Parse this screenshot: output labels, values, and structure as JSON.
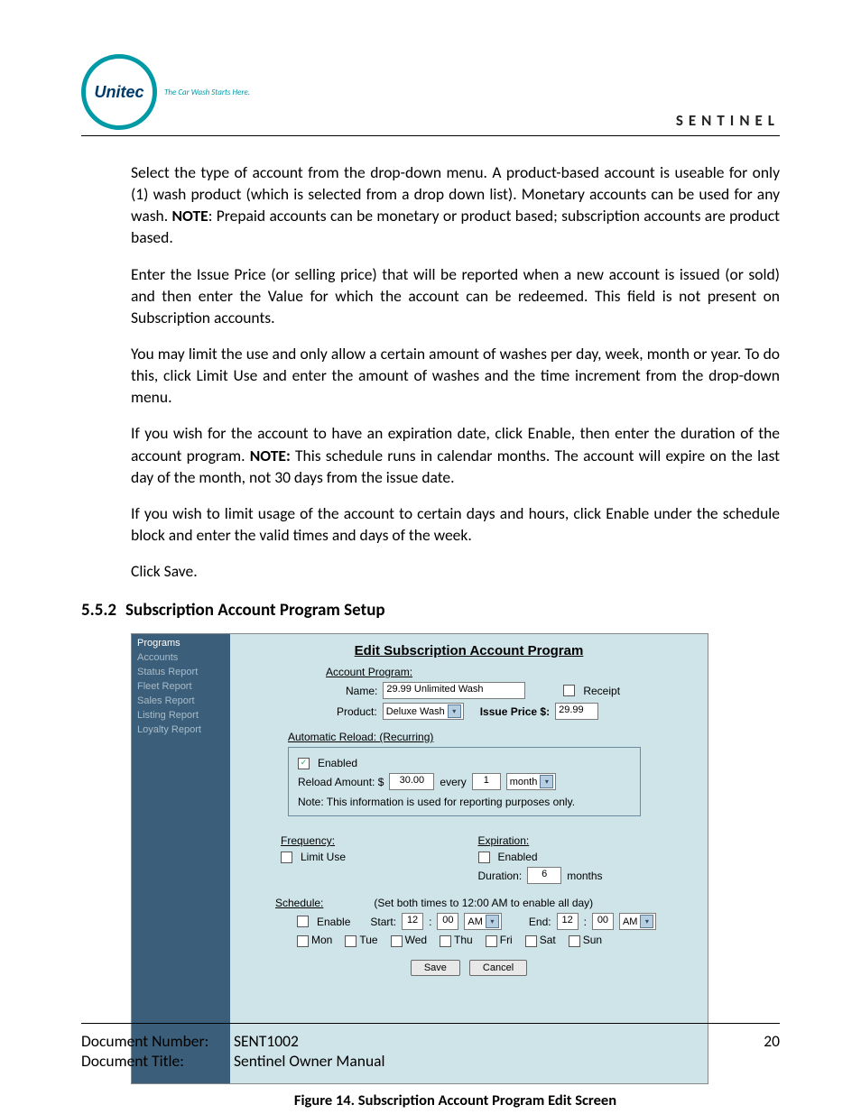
{
  "header": {
    "logo_text": "Unitec",
    "tagline": "The Car Wash Starts Here.",
    "brand": "SENTINEL"
  },
  "paragraphs": {
    "p1a": "Select the type of account from the drop-down menu. A product-based account is useable for only (1) wash product (which is selected from a drop down list). Monetary accounts can be used for any wash. ",
    "p1b": "NOTE",
    "p1c": ": Prepaid accounts can be monetary or product based; subscription accounts are product based.",
    "p2": "Enter the Issue Price (or selling price) that will be reported when a new account is issued (or sold) and then enter the Value for which the account can be redeemed. This field is not present on Subscription accounts.",
    "p3": "You may limit the use and only allow a certain amount of washes per day, week, month or year. To do this, click Limit Use and enter the amount of washes and the time increment from the drop-down menu.",
    "p4a": "If you wish for the account to have an expiration date, click Enable, then enter the duration of the account program. ",
    "p4b": "NOTE:",
    "p4c": " This schedule runs in calendar months. The account will expire on the last day of the month, not 30 days from the issue date.",
    "p5": "If you wish to limit usage of the account to certain days and hours, click Enable under the schedule block and enter the valid times and days of the week.",
    "p6": "Click Save."
  },
  "section": {
    "num": "5.5.2",
    "title": "Subscription Account Program Setup"
  },
  "shot": {
    "sidebar": {
      "items": [
        {
          "label": "Programs",
          "active": true
        },
        {
          "label": "Accounts"
        },
        {
          "label": "Status Report"
        },
        {
          "label": "Fleet Report"
        },
        {
          "label": "Sales Report"
        },
        {
          "label": "Listing Report"
        },
        {
          "label": "Loyalty Report"
        }
      ]
    },
    "title": "Edit Subscription Account Program",
    "account_program_label": "Account Program:",
    "name_label": "Name:",
    "name_value": "29.99 Unlimited Wash",
    "receipt_label": "Receipt",
    "product_label": "Product:",
    "product_value": "Deluxe Wash",
    "issue_price_label": "Issue Price $:",
    "issue_price_value": "29.99",
    "reload_header": "Automatic Reload: (Recurring)",
    "enabled_label": "Enabled",
    "reload_amount_label": "Reload Amount: $",
    "reload_amount_value": "30.00",
    "every_label": "every",
    "every_value": "1",
    "period_value": "month",
    "reload_note": "Note: This information is used for reporting purposes only.",
    "frequency_label": "Frequency:",
    "limit_use_label": "Limit Use",
    "expiration_label": "Expiration:",
    "exp_enabled_label": "Enabled",
    "duration_label": "Duration:",
    "duration_value": "6",
    "duration_unit": "months",
    "schedule_label": "Schedule:",
    "schedule_hint": "(Set both times to 12:00 AM to enable all day)",
    "enable_label": "Enable",
    "start_label": "Start:",
    "start_h": "12",
    "start_m": "00",
    "start_ampm": "AM",
    "end_label": "End:",
    "end_h": "12",
    "end_m": "00",
    "end_ampm": "AM",
    "days": [
      "Mon",
      "Tue",
      "Wed",
      "Thu",
      "Fri",
      "Sat",
      "Sun"
    ],
    "save": "Save",
    "cancel": "Cancel"
  },
  "caption": "Figure 14. Subscription Account Program Edit Screen",
  "footer": {
    "docnum_label": "Document Number:",
    "docnum": "SENT1002",
    "page": "20",
    "title_label": "Document Title:",
    "title": "Sentinel Owner Manual"
  }
}
